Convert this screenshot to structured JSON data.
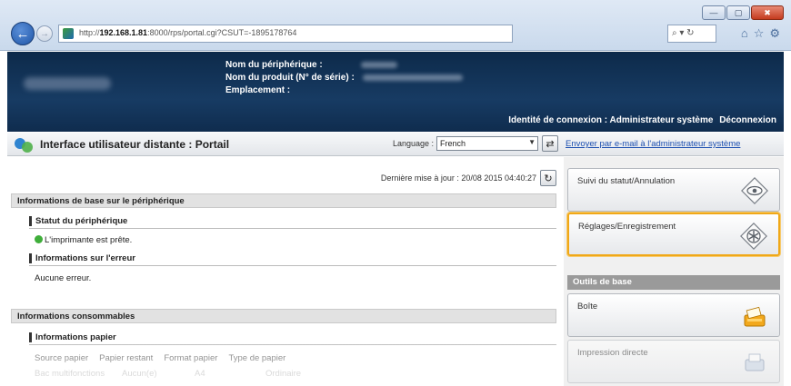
{
  "browser": {
    "url_prefix": "http://",
    "url_host": "192.168.1.81",
    "url_rest": ":8000/rps/portal.cgi?CSUT=-1895178764",
    "search_placeholder": "⌕ ▾ ↻",
    "win_minimize": "—",
    "win_maximize": "▢",
    "win_close": "✖",
    "back_glyph": "←",
    "fwd_glyph": "→",
    "tools": [
      "⌂",
      "☆",
      "⚙"
    ]
  },
  "header": {
    "device_name_label": "Nom du périphérique :",
    "product_name_label": "Nom du produit (N° de série) :",
    "location_label": "Emplacement :",
    "login_text": "Identité de connexion : Administrateur système",
    "logout_link": "Déconnexion"
  },
  "portal": {
    "title": "Interface utilisateur distante : Portail",
    "language_label": "Language :",
    "language_value": "French",
    "language_go": "⇄",
    "email_link": "Envoyer par e-mail à l'administrateur système"
  },
  "main": {
    "updated_text": "Dernière mise à jour : 20/08 2015 04:40:27",
    "refresh_glyph": "↻",
    "basic_info_header": "Informations de base sur le périphérique",
    "device_status_head": "Statut du périphérique",
    "device_status_value": "L'imprimante est prête.",
    "error_info_head": "Informations sur l'erreur",
    "error_value": "Aucune erreur.",
    "consumables_header": "Informations consommables",
    "paper_info_head": "Informations papier",
    "paper_columns": [
      "Source papier",
      "Papier restant",
      "Format papier",
      "Type de papier"
    ],
    "paper_row": [
      "Bac multifonctions",
      "Aucun(e)",
      "A4",
      "Ordinaire"
    ]
  },
  "side": {
    "status_cancel": "Suivi du statut/Annulation",
    "settings_registration": "Réglages/Enregistrement",
    "basic_tools_header": "Outils de base",
    "mailbox": "Boîte",
    "direct_print": "Impression directe"
  },
  "colors": {
    "header_bg": "#173b63",
    "highlight": "#f0a818",
    "link": "#1c4fb0",
    "ok": "#3fae3a"
  }
}
